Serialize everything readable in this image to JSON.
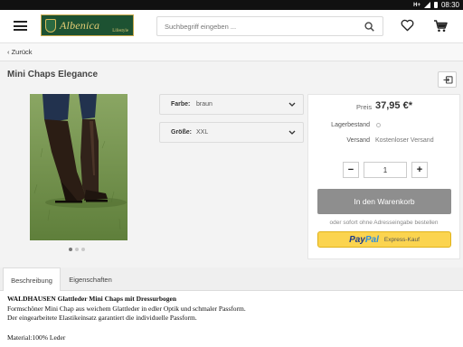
{
  "status_bar": {
    "network": "H+",
    "time": "08:30"
  },
  "header": {
    "logo_text": "Albenica",
    "logo_subtext": "Lifestyle",
    "search_placeholder": "Suchbegriff eingeben ..."
  },
  "breadcrumb": {
    "back_label": "Zurück"
  },
  "product": {
    "title": "Mini Chaps Elegance",
    "image_count": 3,
    "active_image": 1
  },
  "options": {
    "color_label": "Farbe:",
    "color_value": "braun",
    "size_label": "Größe:",
    "size_value": "XXL"
  },
  "buybox": {
    "price_label": "Preis",
    "price": "37,95 €*",
    "stock_label": "Lagerbestand",
    "shipping_label": "Versand",
    "shipping_value": "Kostenloser Versand",
    "quantity": "1",
    "minus_label": "−",
    "plus_label": "+",
    "add_to_cart": "In den Warenkorb",
    "express_note": "oder sofort ohne Adresseingabe bestellen",
    "paypal_pay": "Pay",
    "paypal_pal": "Pal",
    "paypal_express": "Express-Kauf"
  },
  "tabs": [
    {
      "label": "Beschreibung",
      "active": true
    },
    {
      "label": "Eigenschaften",
      "active": false
    }
  ],
  "description": {
    "heading": "WALDHAUSEN Glattleder Mini Chaps mit Dressurbogen",
    "line1": "Formschöner Mini Chap aus weichem Glattleder in edler Optik und schmaler Passform.",
    "line2": "Der eingearbeitete Elastikeinsatz garantiert die individuelle Passform.",
    "material": "Material:100% Leder"
  },
  "colors": {
    "logo_green": "#1d5232",
    "logo_gold": "#e7cf76",
    "cart_button": "#8e8e8e",
    "paypal_yellow": "#fbd44f"
  }
}
